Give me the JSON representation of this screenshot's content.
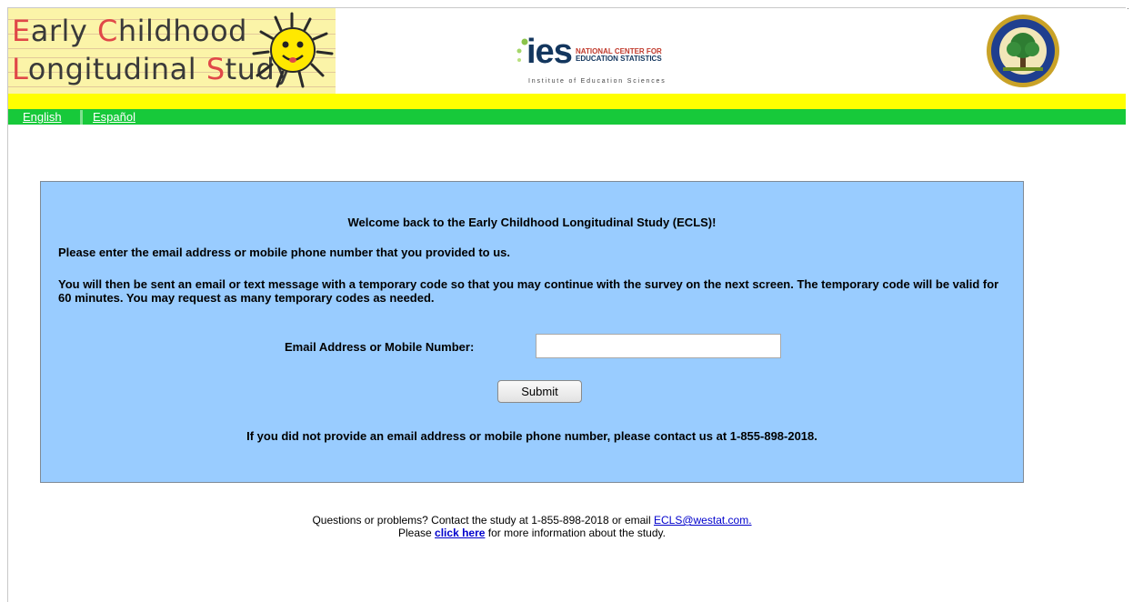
{
  "header": {
    "ecls_logo": {
      "line1": [
        {
          "text": "E",
          "cap": true
        },
        {
          "text": "arly ",
          "cap": false
        },
        {
          "text": "C",
          "cap": true
        },
        {
          "text": "hildhood",
          "cap": false
        }
      ],
      "line2": [
        {
          "text": "L",
          "cap": true
        },
        {
          "text": "ongitudinal ",
          "cap": false
        },
        {
          "text": "S",
          "cap": true
        },
        {
          "text": "tudy",
          "cap": false
        }
      ]
    },
    "ies_logo": {
      "word": "ies",
      "nces_line1": "NATIONAL CENTER FOR",
      "nces_line2": "EDUCATION STATISTICS",
      "subtitle": "Institute of Education Sciences"
    },
    "seal_icon": "us-department-of-education-seal"
  },
  "nav": {
    "english": "English",
    "espanol": "Español"
  },
  "panel": {
    "welcome": "Welcome back to the Early Childhood Longitudinal Study (ECLS)!",
    "enter_prompt": "Please enter the email address or mobile phone number that you provided to us.",
    "code_info": "You will then be sent an email or text message with a temporary code so that you may continue with the survey on the next screen. The temporary code will be valid for 60 minutes. You may request as many temporary codes as needed.",
    "field_label": "Email Address or Mobile Number:",
    "field_value": "",
    "submit_label": "Submit",
    "no_contact_text": "If you did not provide an email address or mobile phone number, please contact us at 1-855-898-2018."
  },
  "footer": {
    "line1_prefix": "Questions or problems? Contact the study at 1-855-898-2018 or email ",
    "email_link": "ECLS@westat.com.",
    "line2_prefix": "Please ",
    "click_here": "click here",
    "line2_suffix": " for more information about the study."
  },
  "colors": {
    "yellow_bar": "#ffff00",
    "green_bar": "#17c93a",
    "panel_bg": "#99ccff",
    "logo_bg": "#fbf4a8",
    "link": "#0000cc"
  }
}
